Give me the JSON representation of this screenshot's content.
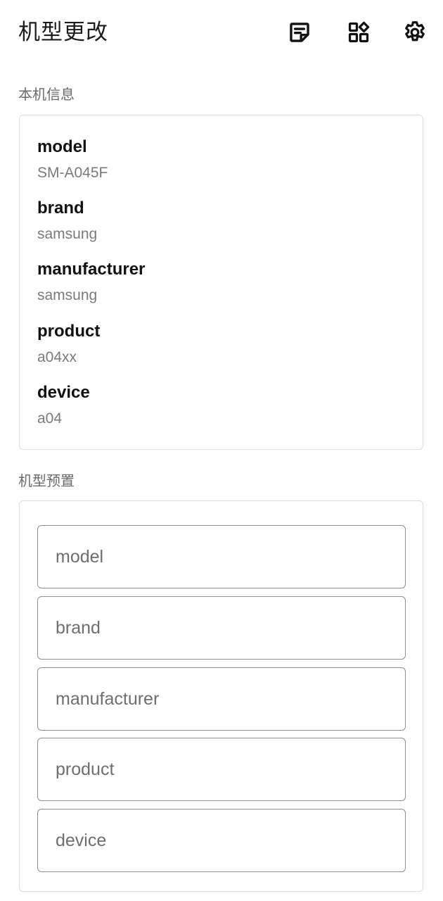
{
  "app_bar": {
    "title": "机型更改",
    "actions": [
      {
        "name": "notes",
        "icon": "sticky-note-icon"
      },
      {
        "name": "widgets",
        "icon": "widgets-icon"
      },
      {
        "name": "settings",
        "icon": "gear-icon"
      }
    ]
  },
  "device_info": {
    "section_title": "本机信息",
    "items": [
      {
        "key": "model",
        "value": "SM-A045F"
      },
      {
        "key": "brand",
        "value": "samsung"
      },
      {
        "key": "manufacturer",
        "value": "samsung"
      },
      {
        "key": "product",
        "value": "a04xx"
      },
      {
        "key": "device",
        "value": "a04"
      }
    ]
  },
  "presets": {
    "section_title": "机型预置",
    "fields": [
      {
        "placeholder": "model",
        "value": ""
      },
      {
        "placeholder": "brand",
        "value": ""
      },
      {
        "placeholder": "manufacturer",
        "value": ""
      },
      {
        "placeholder": "product",
        "value": ""
      },
      {
        "placeholder": "device",
        "value": ""
      }
    ]
  },
  "colors": {
    "text_primary": "#1b1b1b",
    "text_secondary": "#7a7a7a",
    "card_border": "#dcdcdc",
    "field_border": "#8f8f8f"
  }
}
